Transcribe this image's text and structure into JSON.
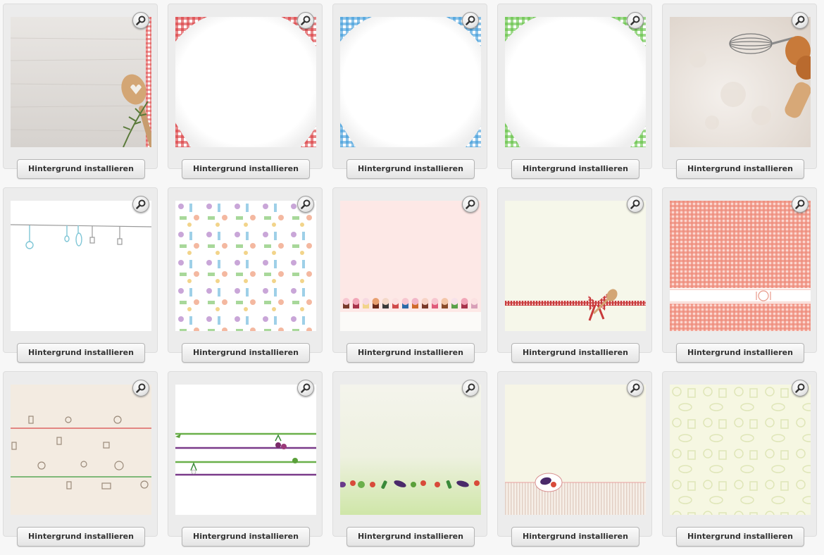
{
  "install_label": "Hintergrund installieren",
  "colors": {
    "card_background": "#ececec",
    "page_background": "#f7f7f7",
    "button_text": "#333333"
  },
  "backgrounds": [
    {
      "id": "wood-spoon",
      "theme": "light wood table with wooden heart spoon and rosemary"
    },
    {
      "id": "gingham-red-corners",
      "theme": "white paper with red checkered cloth corners"
    },
    {
      "id": "gingham-blue-corners",
      "theme": "white paper with blue checkered cloth corners"
    },
    {
      "id": "gingham-green-corners",
      "theme": "white paper with green checkered cloth corners"
    },
    {
      "id": "flour-whisk-eggs",
      "theme": "flour with whisk, eggs and rolling pin"
    },
    {
      "id": "hanging-utensils",
      "theme": "white with hanging kitchen utensils on a line"
    },
    {
      "id": "utensil-pattern",
      "theme": "pastel kitchen utensil pattern"
    },
    {
      "id": "cupcakes-pink",
      "theme": "pink with row of cupcakes"
    },
    {
      "id": "ribbon-bow-spoon",
      "theme": "cream with red gingham ribbon and wooden spoons"
    },
    {
      "id": "red-gingham-plate",
      "theme": "red gingham with plate and cutlery band"
    },
    {
      "id": "beige-kitchen-icons",
      "theme": "beige with kitchen icons and red/green lines"
    },
    {
      "id": "green-purple-lines-veg",
      "theme": "white with green and purple lines and vegetables"
    },
    {
      "id": "green-vegetables-row",
      "theme": "green gradient with row of vegetables"
    },
    {
      "id": "cream-eggplant-stripes",
      "theme": "cream with eggplant badge and stripes"
    },
    {
      "id": "pale-green-pattern",
      "theme": "pale green kitchen pattern"
    }
  ]
}
